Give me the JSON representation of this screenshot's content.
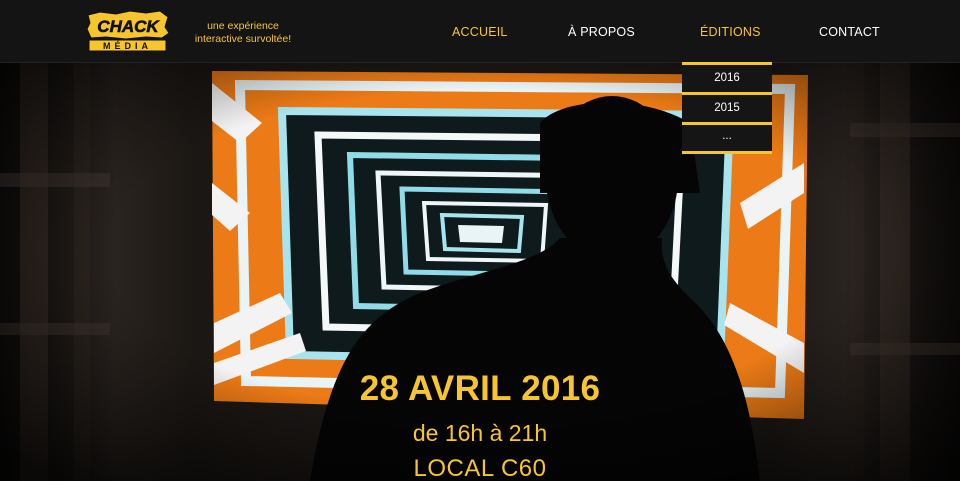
{
  "brand": {
    "logo_top": "CHACK",
    "logo_bottom": "MÉDIA",
    "tagline_line1": "une expérience",
    "tagline_line2": "interactive survoltée!",
    "accent_color": "#f7c52e"
  },
  "nav": {
    "items": [
      {
        "label": "ACCUEIL",
        "state": "active"
      },
      {
        "label": "À PROPOS",
        "state": "normal"
      },
      {
        "label": "ÉDITIONS",
        "state": "open"
      },
      {
        "label": "CONTACT",
        "state": "normal"
      }
    ]
  },
  "editions_dropdown": {
    "items": [
      "2016",
      "2015",
      "..."
    ]
  },
  "hero": {
    "date": "28 AVRIL 2016",
    "time": "de 16h à 21h",
    "place": "LOCAL C60"
  }
}
